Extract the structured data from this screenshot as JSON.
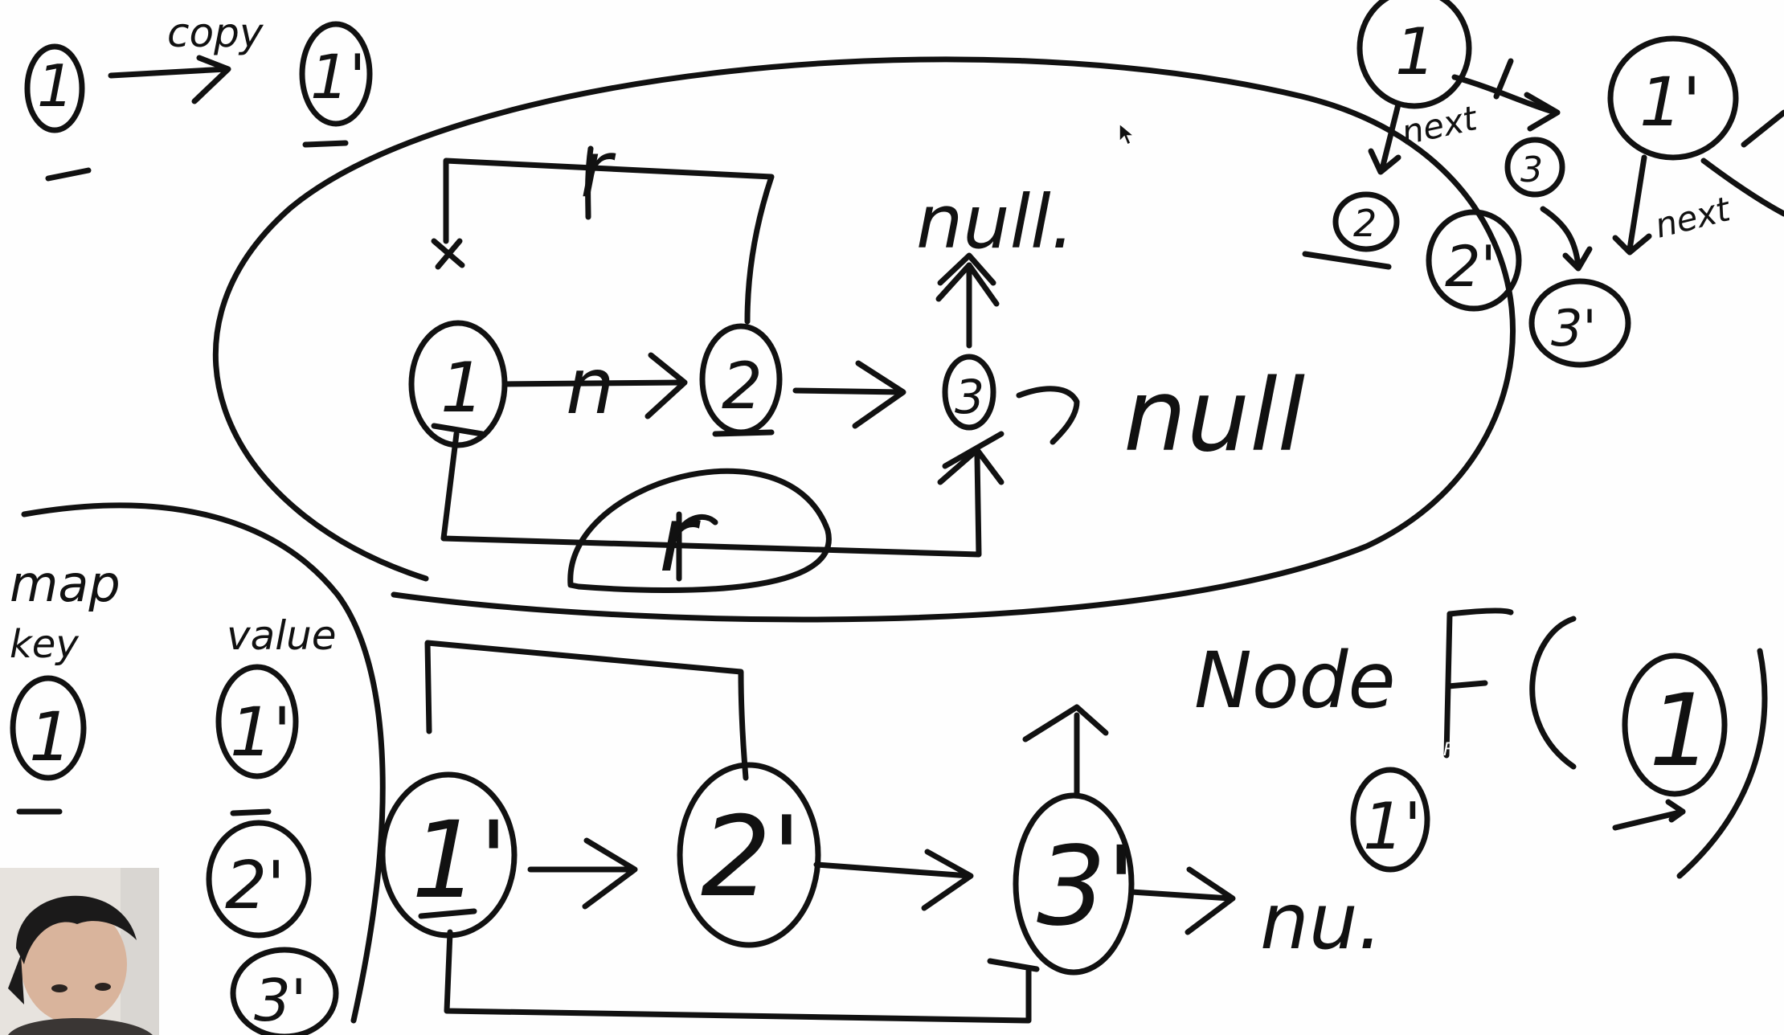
{
  "colors": {
    "background": "#fefefe",
    "ink": "#111111"
  },
  "labels": {
    "copy": "copy",
    "r_top": "r",
    "n_label": "n",
    "null_up": "null.",
    "null_right": "null",
    "r_bottom": "r",
    "map": "map",
    "key": "key",
    "value": "value",
    "node_text": "Node",
    "func_f": "F",
    "null_bottom": "nu.",
    "next_label": "next"
  },
  "nodes": {
    "n1": "1",
    "n1p": "1'",
    "n2": "2",
    "n3": "3",
    "n1pp": "1'",
    "n2p": "2'",
    "n3p": "3'",
    "map_key": "1",
    "map_v1": "1'",
    "map_v2": "2'",
    "map_v3": "3'",
    "arg_1": "1",
    "small_1p": "1'",
    "tr_1": "1",
    "tr_2": "2",
    "tr_3": "3",
    "tr_1p": "1'",
    "tr_2p": "2'",
    "tr_3p": "3'"
  },
  "icons": {
    "cursor": "arrow-cursor-icon",
    "webcam": "presenter-webcam"
  }
}
